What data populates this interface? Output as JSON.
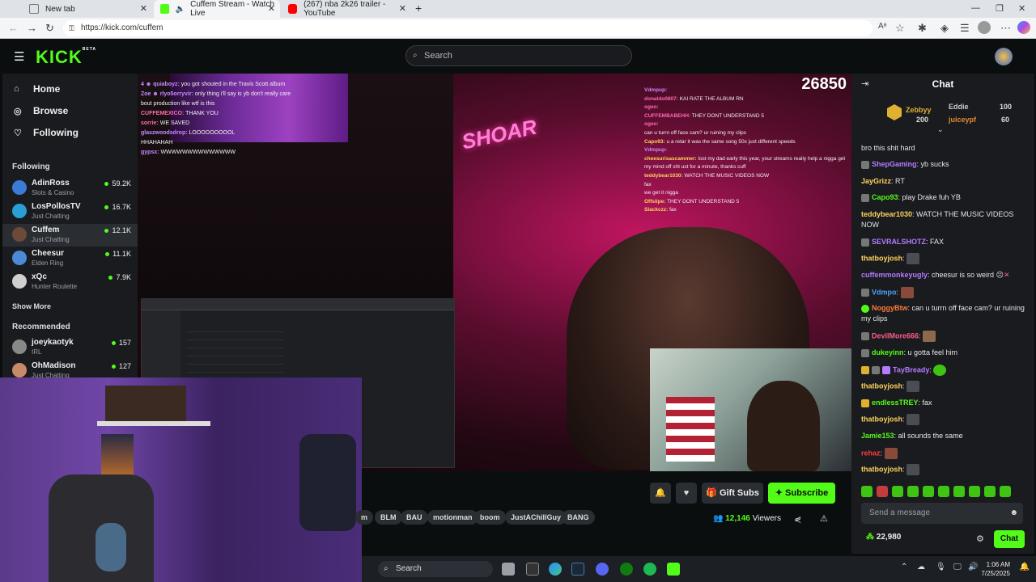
{
  "browser": {
    "tabs": [
      {
        "title": "New tab"
      },
      {
        "title": "Cuffem Stream - Watch Live"
      },
      {
        "title": "(267) nba 2k26 trailer - YouTube"
      }
    ],
    "url": "https://kick.com/cuffem"
  },
  "kick": {
    "logo": "KICK",
    "logo_badge": "BETA",
    "search_placeholder": "Search",
    "nav": [
      {
        "label": "Home",
        "icon": "home-icon"
      },
      {
        "label": "Browse",
        "icon": "compass-icon"
      },
      {
        "label": "Following",
        "icon": "heart-icon"
      }
    ],
    "following_title": "Following",
    "following": [
      {
        "name": "AdinRoss",
        "category": "Slots & Casino",
        "viewers": "59.2K",
        "color": "#3b7bd8"
      },
      {
        "name": "LosPollosTV",
        "category": "Just Chatting",
        "viewers": "16.7K",
        "color": "#2a9fd6"
      },
      {
        "name": "Cuffem",
        "category": "Just Chatting",
        "viewers": "12.1K",
        "color": "#6b4a3a"
      },
      {
        "name": "Cheesur",
        "category": "Elden Ring",
        "viewers": "11.1K",
        "color": "#4a8ad6"
      },
      {
        "name": "xQc",
        "category": "Hunter Roulette",
        "viewers": "7.9K",
        "color": "#cfcfcf"
      }
    ],
    "show_more": "Show More",
    "recommended_title": "Recommended",
    "recommended": [
      {
        "name": "joeykaotyk",
        "category": "IRL",
        "viewers": "157",
        "color": "#888"
      },
      {
        "name": "OhMadison",
        "category": "Just Chatting",
        "viewers": "127",
        "color": "#c98a6a"
      }
    ]
  },
  "video": {
    "viewcount_overlay": "26850",
    "overlay_chat_left": [
      {
        "user": "4 ☻ quiaboyz:",
        "text": "you got shouted in the Travis Scott album"
      },
      {
        "user": "Zoe ☻ rlyo5orryvir:",
        "text": "only thing i'll say is yb don't really care"
      },
      {
        "user": "",
        "text": "bout production like wtf is this"
      },
      {
        "user": "CUFFEMEXICO:",
        "text": "THANK YOU"
      },
      {
        "user": "sorrie:",
        "text": "WE SAVED"
      },
      {
        "user": "glaszwoodsdrop:",
        "text": "LOOOOOOOOOL"
      },
      {
        "user": "",
        "text": "HHAHAHAH"
      },
      {
        "user": "gypsx:",
        "text": "WWWWWWWWWWWWWW"
      }
    ],
    "overlay_chat_right": [
      {
        "user": "Vdmpup:",
        "text": ""
      },
      {
        "user": "donaldo0807:",
        "text": "KAI RATE THE ALBUM RN"
      },
      {
        "user": "ogeo:",
        "text": ""
      },
      {
        "user": "CUFFEMBABEHH:",
        "text": "THEY DONT UNDERSTAND 5"
      },
      {
        "user": "ogeo:",
        "text": ""
      },
      {
        "user": "",
        "text": "can u turrn off face cam? ur ruining my clips"
      },
      {
        "user": "Capo93:",
        "text": "u a retar it was the same song 50x just different speeds"
      },
      {
        "user": "Vdmpup:",
        "text": ""
      },
      {
        "user": "cheesurisascammer:",
        "text": "lost my dad early this year, your streams really help a nigga get my mind off sht ust for a minute, thanks cuff"
      },
      {
        "user": "teddybear1030:",
        "text": "WATCH THE MUSIC VIDEOS NOW"
      },
      {
        "user": "",
        "text": "fax"
      },
      {
        "user": "",
        "text": "we get it nigga"
      },
      {
        "user": "Offslipe:",
        "text": "THEY DONT UNDERSTAND 5"
      },
      {
        "user": "Slackczz:",
        "text": "fax"
      }
    ],
    "neon_sign": "SHOAR"
  },
  "stream_info": {
    "tags": [
      "m",
      "BLM",
      "BAU",
      "motionman",
      "boom",
      "JustAChillGuy",
      "BANG"
    ],
    "gift_subs": "Gift Subs",
    "subscribe": "Subscribe",
    "viewers_count": "12,146",
    "viewers_label": "Viewers"
  },
  "chat": {
    "title": "Chat",
    "leaderboard": [
      {
        "name": "Zebbyy",
        "value": "200"
      },
      {
        "name": "Eddie",
        "value": "100"
      },
      {
        "name": "juiceypf",
        "value": "60"
      }
    ],
    "messages": [
      {
        "user": "",
        "text": "bro this shit hard",
        "color": "#e6e6e6"
      },
      {
        "user": "ShepGaming",
        "text": ": yb sucks",
        "color": "#b57bff"
      },
      {
        "user": "JayGrizz",
        "text": ": RT",
        "color": "#ffd35c"
      },
      {
        "user": "Capo93",
        "text": ": play Drake fuh YB",
        "color": "#53fc18"
      },
      {
        "user": "teddybear1030",
        "text": ": WATCH THE MUSIC VIDEOS NOW",
        "color": "#ffd35c"
      },
      {
        "user": "SEVRALSHOTZ",
        "text": ": FAX",
        "color": "#b57bff"
      },
      {
        "user": "thatboyjosh",
        "text": ":",
        "color": "#ffd35c"
      },
      {
        "user": "cuffemmonkeyugly",
        "text": ": cheesur is so weird",
        "color": "#b57bff"
      },
      {
        "user": "Vdmpo",
        "text": ":",
        "color": "#4aa3ff"
      },
      {
        "user": "NoggyBtw",
        "text": ": can u turrn off face cam? ur ruining my clips",
        "color": "#ff7a3c"
      },
      {
        "user": "DevilMore666",
        "text": ":",
        "color": "#ff5c8a"
      },
      {
        "user": "dukeyinn",
        "text": ": u gotta feel him",
        "color": "#53fc18"
      },
      {
        "user": "TayBready",
        "text": ":",
        "color": "#b57bff"
      },
      {
        "user": "thatboyjosh",
        "text": ":",
        "color": "#ffd35c"
      },
      {
        "user": "endlessTREY",
        "text": ": fax",
        "color": "#53fc18"
      },
      {
        "user": "thatboyjosh",
        "text": ":",
        "color": "#ffd35c"
      },
      {
        "user": "Jamie153",
        "text": ": all sounds the same",
        "color": "#53fc18"
      },
      {
        "user": "rehaz",
        "text": ":",
        "color": "#ff3c3c"
      },
      {
        "user": "thatboyjosh",
        "text": ":",
        "color": "#ffd35c"
      }
    ],
    "input_placeholder": "Send a message",
    "points": "22,980",
    "send_label": "Chat"
  },
  "taskbar": {
    "search_placeholder": "Search",
    "time": "1:06 AM",
    "date": "7/25/2025"
  }
}
